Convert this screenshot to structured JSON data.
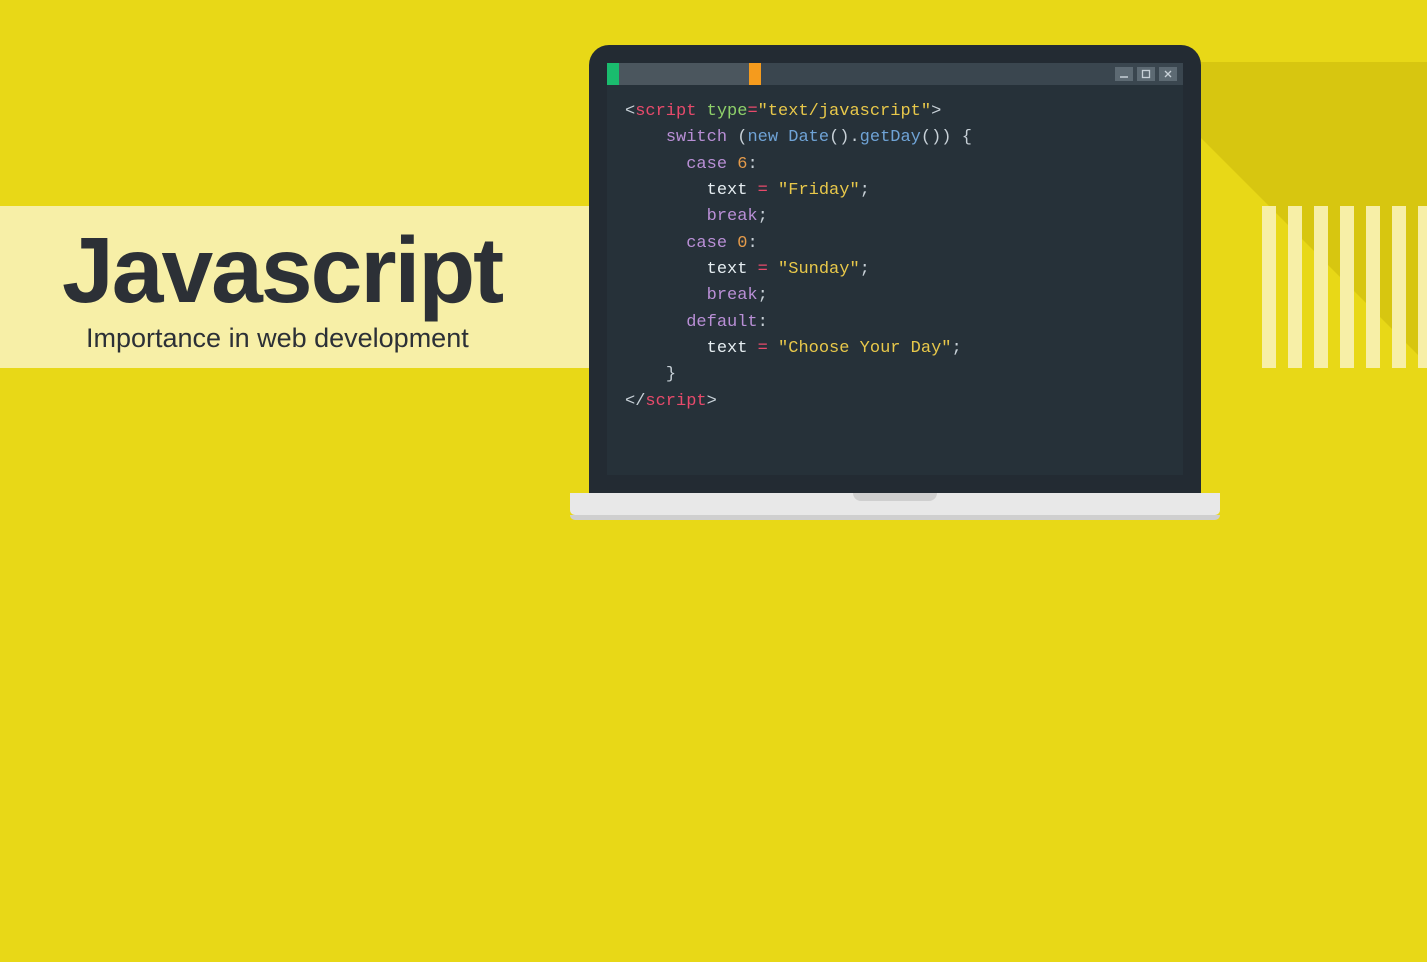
{
  "title": "Javascript",
  "subtitle": "Importance in web development",
  "code": {
    "script_open_tag": "script",
    "type_attr": "type",
    "type_val": "\"text/javascript\"",
    "switch": "switch",
    "new": "new",
    "date": "Date",
    "getDay": "getDay",
    "case": "case",
    "six": "6",
    "zero": "0",
    "text": "text",
    "friday": "\"Friday\"",
    "sunday": "\"Sunday\"",
    "choose": "\"Choose Your Day\"",
    "break": "break",
    "default": "default",
    "script_close": "script"
  },
  "window_controls": [
    "minimize",
    "maximize",
    "close"
  ]
}
